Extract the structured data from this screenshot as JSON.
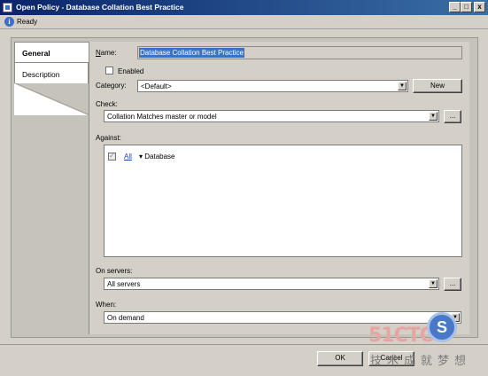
{
  "window": {
    "title": "Open Policy - Database Collation Best Practice",
    "minimize": "_",
    "maximize": "□",
    "close": "x"
  },
  "status": {
    "icon": "info-icon",
    "text": "Ready"
  },
  "tabs": [
    {
      "label": "General",
      "selected": true
    },
    {
      "label": "Description",
      "selected": false
    }
  ],
  "general": {
    "name_label": "Name:",
    "name_value": "Database Collation Best Practice",
    "enabled_label": "Enabled",
    "enabled_checked": false,
    "category_label": "Category:",
    "category_value": "<Default>",
    "new_button": "New",
    "check_label": "Check:",
    "check_value": "Collation Matches master or model",
    "check_browse": "...",
    "against_label": "Against:",
    "against_item": {
      "checked": true,
      "link": "All",
      "target": "Database"
    },
    "servers_label": "On servers:",
    "servers_value": "All servers",
    "servers_browse": "...",
    "when_label": "When:",
    "when_value": "On demand"
  },
  "footer": {
    "ok": "OK",
    "cancel": "Cancel"
  },
  "watermark": {
    "number": "51CTO",
    "text": "技术成就梦想"
  },
  "colors": {
    "titlebar": "#0a246a",
    "selection": "#3b73c4",
    "link": "#1f3fb3"
  }
}
